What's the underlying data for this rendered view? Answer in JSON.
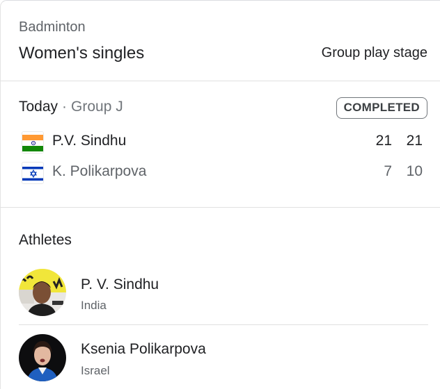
{
  "header": {
    "sport": "Badminton",
    "event": "Women's singles",
    "stage": "Group play stage"
  },
  "match": {
    "date": "Today",
    "separator": "·",
    "group": "Group J",
    "status": "COMPLETED",
    "players": [
      {
        "name": "P.V. Sindhu",
        "flag": "india-flag-icon",
        "scores": [
          "21",
          "21"
        ]
      },
      {
        "name": "K. Polikarpova",
        "flag": "israel-flag-icon",
        "scores": [
          "7",
          "10"
        ]
      }
    ]
  },
  "athletes": {
    "title": "Athletes",
    "items": [
      {
        "name": "P. V. Sindhu",
        "country": "India"
      },
      {
        "name": "Ksenia Polikarpova",
        "country": "Israel"
      }
    ]
  },
  "colors": {
    "primary_text": "#202124",
    "secondary_text": "#5f6368",
    "divider": "#e0e0e0",
    "india_saffron": "#ff9933",
    "india_green": "#138808",
    "israel_blue": "#0038b8"
  }
}
